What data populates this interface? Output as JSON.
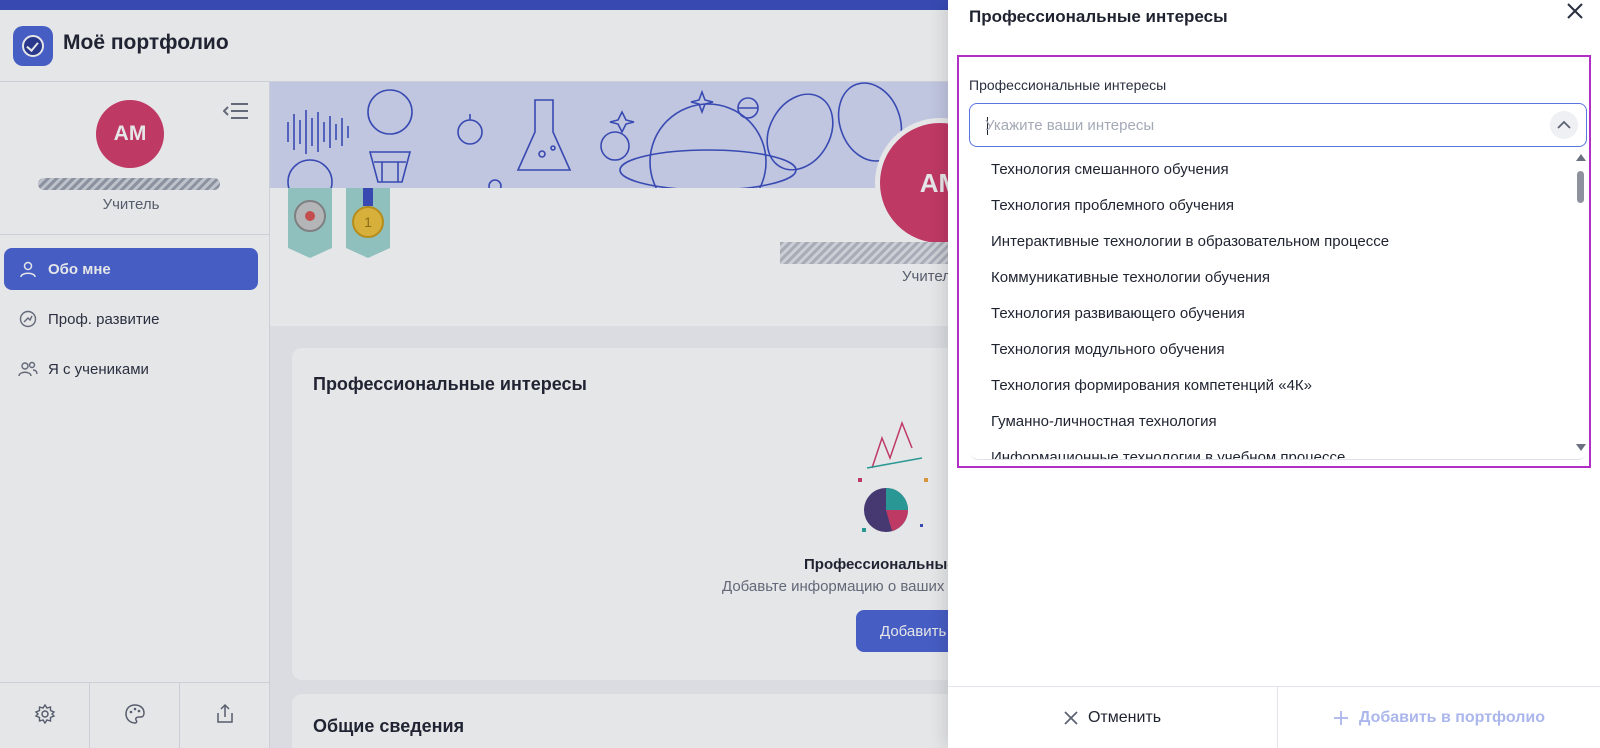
{
  "app": {
    "title": "Моё портфолио",
    "accent_color": "#4b63d6",
    "avatar_color": "#d43b6a"
  },
  "profile": {
    "initials": "АМ",
    "role": "Учитель",
    "role_truncated": "Учител"
  },
  "sidebar": {
    "items": [
      {
        "label": "Обо мне",
        "icon": "user-icon",
        "active": true
      },
      {
        "label": "Проф. развитие",
        "icon": "growth-icon",
        "active": false
      },
      {
        "label": "Я с учениками",
        "icon": "users-icon",
        "active": false
      }
    ],
    "footer_icons": [
      "settings-icon",
      "palette-icon",
      "share-icon"
    ]
  },
  "main": {
    "interests_card": {
      "title": "Профессиональные интересы",
      "empty_title": "Профессиональные ин",
      "empty_subtitle": "Добавьте информацию о ваших п",
      "add_button": "Добавить ин"
    },
    "general_card": {
      "title": "Общие сведения"
    }
  },
  "drawer": {
    "title": "Профессиональные интересы",
    "field_label": "Профессиональные интересы",
    "select": {
      "placeholder": "Укажите ваши интересы",
      "value": "",
      "expanded": true
    },
    "options": [
      "Технология смешанного обучения",
      "Технология проблемного обучения",
      "Интерактивные технологии в образовательном процессе",
      "Коммуникативные технологии обучения",
      "Технология развивающего обучения",
      "Технология модульного обучения",
      "Технология формирования компетенций «4К»",
      "Гуманно-личностная технология",
      "Информационные технологии в учебном процессе"
    ],
    "cancel_label": "Отменить",
    "submit_label": "Добавить в портфолио",
    "submit_disabled": true,
    "highlight_color": "#b02fc4"
  }
}
